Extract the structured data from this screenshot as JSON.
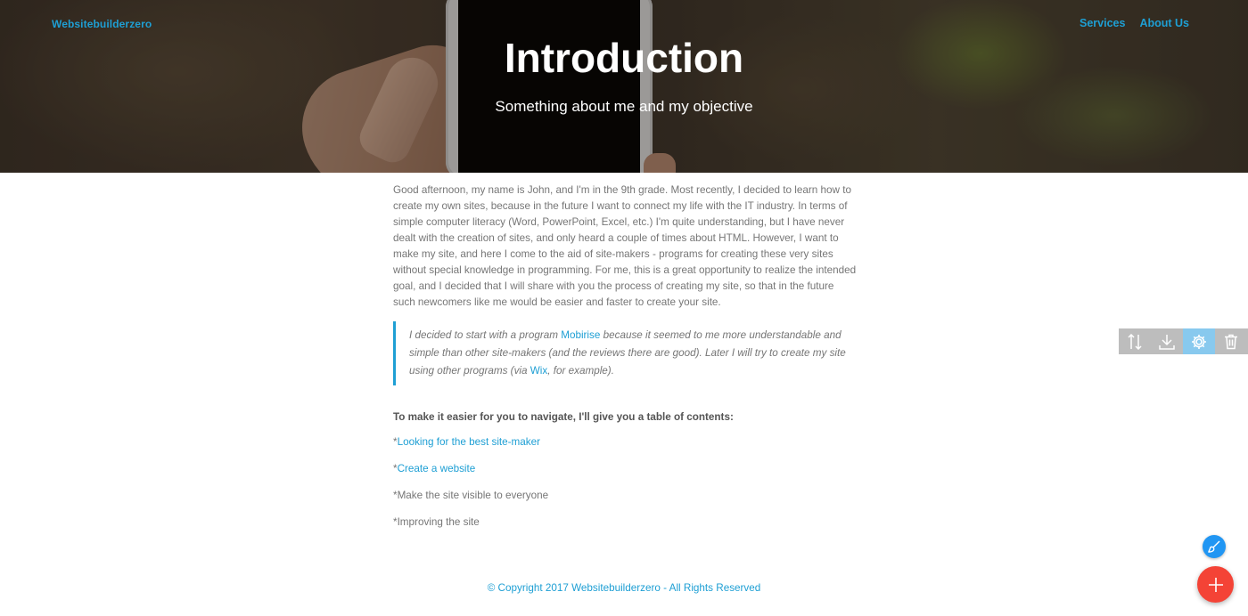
{
  "header": {
    "brand": "Websitebuilderzero",
    "nav": [
      {
        "label": "Services"
      },
      {
        "label": "About Us"
      }
    ]
  },
  "hero": {
    "title": "Introduction",
    "subtitle": "Something about me and my objective"
  },
  "article": {
    "intro": "Good afternoon, my name is John, and I'm in the 9th grade. Most recently, I decided to learn how to create my own sites, because in the future I want to connect my life with the IT industry. In terms of simple computer literacy (Word, PowerPoint, Excel, etc.) I'm quite understanding, but I have never dealt with the creation of sites, and only heard a couple of times about HTML. However, I want to make my site, and here I come to the aid of site-makers - programs for creating these very sites without special knowledge in programming. For me, this is a great opportunity to realize the intended goal, and I decided that I will share with you the process of creating my site, so that in the future such newcomers like me would be easier and faster to create your site.",
    "quote": {
      "part1": "I decided to start with a program ",
      "link1": "Mobirise",
      "part2": " because it seemed to me more understandable and simple than other site-makers (and the reviews there are good). Later I will try to create my site using other programs (via ",
      "link2": "Wix",
      "part3": ", for example)."
    },
    "toc_title": "To make it easier for you to navigate, I'll give you a table of contents:",
    "toc": [
      {
        "prefix": "*",
        "label": "Looking for the best site-maker",
        "link": true
      },
      {
        "prefix": "*",
        "label": "Create a website",
        "link": true
      },
      {
        "prefix": "*",
        "label": "Make the site visible to everyone",
        "link": false
      },
      {
        "prefix": "*",
        "label": "Improving the site",
        "link": false
      }
    ]
  },
  "footer": {
    "copyright": "© Copyright 2017 Websitebuilderzero - All Rights Reserved"
  },
  "editor_toolbar": {
    "icons": [
      "sort-icon",
      "download-icon",
      "gear-icon",
      "trash-icon"
    ],
    "active": "gear-icon",
    "bg_color": "#bdbdbd",
    "active_color": "#88c9ee"
  },
  "fabs": {
    "small_icon": "brush-icon",
    "small_color": "#2196f3",
    "big_icon": "plus-icon",
    "big_color": "#f44336"
  },
  "colors": {
    "accent": "#1e9fd4",
    "text": "#767676"
  }
}
